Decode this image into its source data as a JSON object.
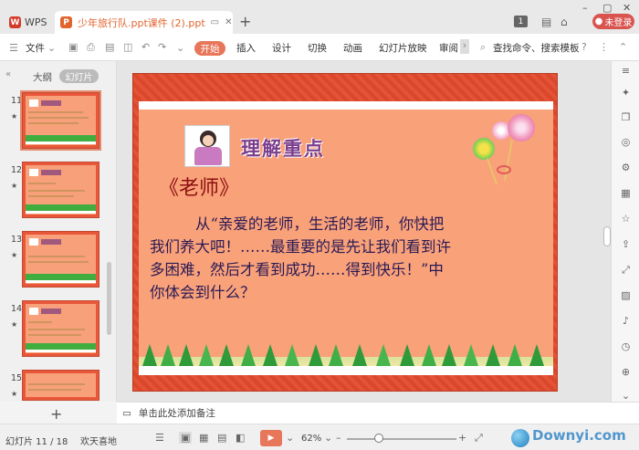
{
  "titlebar": {
    "app_tab": "WPS",
    "doc_tab": "少年旅行队.ppt课件 (2).ppt",
    "login": "未登录",
    "page_badge": "1"
  },
  "toolbar": {
    "file": "文件",
    "start": "开始",
    "insert": "插入",
    "design": "设计",
    "transition": "切换",
    "animation": "动画",
    "slideshow": "幻灯片放映",
    "review": "审阅",
    "search": "查找命令、搜索模板"
  },
  "leftpanel": {
    "outline_tab": "大纲",
    "slides_tab": "幻灯片",
    "thumbnails": [
      {
        "num": "11"
      },
      {
        "num": "12"
      },
      {
        "num": "13"
      },
      {
        "num": "14"
      },
      {
        "num": "15"
      }
    ]
  },
  "slide": {
    "title": "理解重点",
    "subheading": "《老师》",
    "body_lines": [
      "从“亲爱的老师，生活的老师，你快把",
      "我们养大吧！……最重要的是先让我们看到许",
      "多困难，然后才看到成功……得到快乐！”中",
      "你体会到什么？"
    ]
  },
  "notes": {
    "placeholder": "单击此处添加备注"
  },
  "status": {
    "slide_counter": "幻灯片 11 / 18",
    "theme": "欢天喜地",
    "zoom": "62%"
  },
  "watermark": {
    "text": "Downyi.com"
  },
  "colors": {
    "accent": "#e8765a",
    "slide_frame": "#e34a2c",
    "slide_bg": "#f9a179",
    "title_color": "#7b3e8e",
    "body_color": "#2a1a55",
    "login": "#d9534f"
  }
}
